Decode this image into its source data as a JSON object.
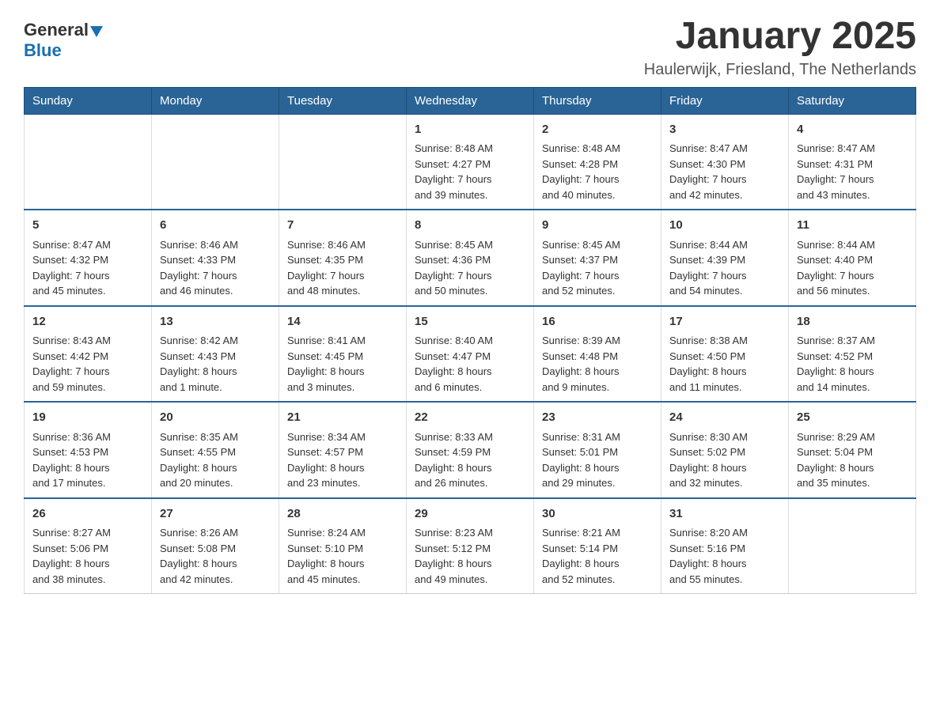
{
  "logo": {
    "general": "General",
    "blue": "Blue"
  },
  "header": {
    "title": "January 2025",
    "subtitle": "Haulerwijk, Friesland, The Netherlands"
  },
  "weekdays": [
    "Sunday",
    "Monday",
    "Tuesday",
    "Wednesday",
    "Thursday",
    "Friday",
    "Saturday"
  ],
  "weeks": [
    [
      {
        "day": "",
        "info": ""
      },
      {
        "day": "",
        "info": ""
      },
      {
        "day": "",
        "info": ""
      },
      {
        "day": "1",
        "info": "Sunrise: 8:48 AM\nSunset: 4:27 PM\nDaylight: 7 hours\nand 39 minutes."
      },
      {
        "day": "2",
        "info": "Sunrise: 8:48 AM\nSunset: 4:28 PM\nDaylight: 7 hours\nand 40 minutes."
      },
      {
        "day": "3",
        "info": "Sunrise: 8:47 AM\nSunset: 4:30 PM\nDaylight: 7 hours\nand 42 minutes."
      },
      {
        "day": "4",
        "info": "Sunrise: 8:47 AM\nSunset: 4:31 PM\nDaylight: 7 hours\nand 43 minutes."
      }
    ],
    [
      {
        "day": "5",
        "info": "Sunrise: 8:47 AM\nSunset: 4:32 PM\nDaylight: 7 hours\nand 45 minutes."
      },
      {
        "day": "6",
        "info": "Sunrise: 8:46 AM\nSunset: 4:33 PM\nDaylight: 7 hours\nand 46 minutes."
      },
      {
        "day": "7",
        "info": "Sunrise: 8:46 AM\nSunset: 4:35 PM\nDaylight: 7 hours\nand 48 minutes."
      },
      {
        "day": "8",
        "info": "Sunrise: 8:45 AM\nSunset: 4:36 PM\nDaylight: 7 hours\nand 50 minutes."
      },
      {
        "day": "9",
        "info": "Sunrise: 8:45 AM\nSunset: 4:37 PM\nDaylight: 7 hours\nand 52 minutes."
      },
      {
        "day": "10",
        "info": "Sunrise: 8:44 AM\nSunset: 4:39 PM\nDaylight: 7 hours\nand 54 minutes."
      },
      {
        "day": "11",
        "info": "Sunrise: 8:44 AM\nSunset: 4:40 PM\nDaylight: 7 hours\nand 56 minutes."
      }
    ],
    [
      {
        "day": "12",
        "info": "Sunrise: 8:43 AM\nSunset: 4:42 PM\nDaylight: 7 hours\nand 59 minutes."
      },
      {
        "day": "13",
        "info": "Sunrise: 8:42 AM\nSunset: 4:43 PM\nDaylight: 8 hours\nand 1 minute."
      },
      {
        "day": "14",
        "info": "Sunrise: 8:41 AM\nSunset: 4:45 PM\nDaylight: 8 hours\nand 3 minutes."
      },
      {
        "day": "15",
        "info": "Sunrise: 8:40 AM\nSunset: 4:47 PM\nDaylight: 8 hours\nand 6 minutes."
      },
      {
        "day": "16",
        "info": "Sunrise: 8:39 AM\nSunset: 4:48 PM\nDaylight: 8 hours\nand 9 minutes."
      },
      {
        "day": "17",
        "info": "Sunrise: 8:38 AM\nSunset: 4:50 PM\nDaylight: 8 hours\nand 11 minutes."
      },
      {
        "day": "18",
        "info": "Sunrise: 8:37 AM\nSunset: 4:52 PM\nDaylight: 8 hours\nand 14 minutes."
      }
    ],
    [
      {
        "day": "19",
        "info": "Sunrise: 8:36 AM\nSunset: 4:53 PM\nDaylight: 8 hours\nand 17 minutes."
      },
      {
        "day": "20",
        "info": "Sunrise: 8:35 AM\nSunset: 4:55 PM\nDaylight: 8 hours\nand 20 minutes."
      },
      {
        "day": "21",
        "info": "Sunrise: 8:34 AM\nSunset: 4:57 PM\nDaylight: 8 hours\nand 23 minutes."
      },
      {
        "day": "22",
        "info": "Sunrise: 8:33 AM\nSunset: 4:59 PM\nDaylight: 8 hours\nand 26 minutes."
      },
      {
        "day": "23",
        "info": "Sunrise: 8:31 AM\nSunset: 5:01 PM\nDaylight: 8 hours\nand 29 minutes."
      },
      {
        "day": "24",
        "info": "Sunrise: 8:30 AM\nSunset: 5:02 PM\nDaylight: 8 hours\nand 32 minutes."
      },
      {
        "day": "25",
        "info": "Sunrise: 8:29 AM\nSunset: 5:04 PM\nDaylight: 8 hours\nand 35 minutes."
      }
    ],
    [
      {
        "day": "26",
        "info": "Sunrise: 8:27 AM\nSunset: 5:06 PM\nDaylight: 8 hours\nand 38 minutes."
      },
      {
        "day": "27",
        "info": "Sunrise: 8:26 AM\nSunset: 5:08 PM\nDaylight: 8 hours\nand 42 minutes."
      },
      {
        "day": "28",
        "info": "Sunrise: 8:24 AM\nSunset: 5:10 PM\nDaylight: 8 hours\nand 45 minutes."
      },
      {
        "day": "29",
        "info": "Sunrise: 8:23 AM\nSunset: 5:12 PM\nDaylight: 8 hours\nand 49 minutes."
      },
      {
        "day": "30",
        "info": "Sunrise: 8:21 AM\nSunset: 5:14 PM\nDaylight: 8 hours\nand 52 minutes."
      },
      {
        "day": "31",
        "info": "Sunrise: 8:20 AM\nSunset: 5:16 PM\nDaylight: 8 hours\nand 55 minutes."
      },
      {
        "day": "",
        "info": ""
      }
    ]
  ]
}
